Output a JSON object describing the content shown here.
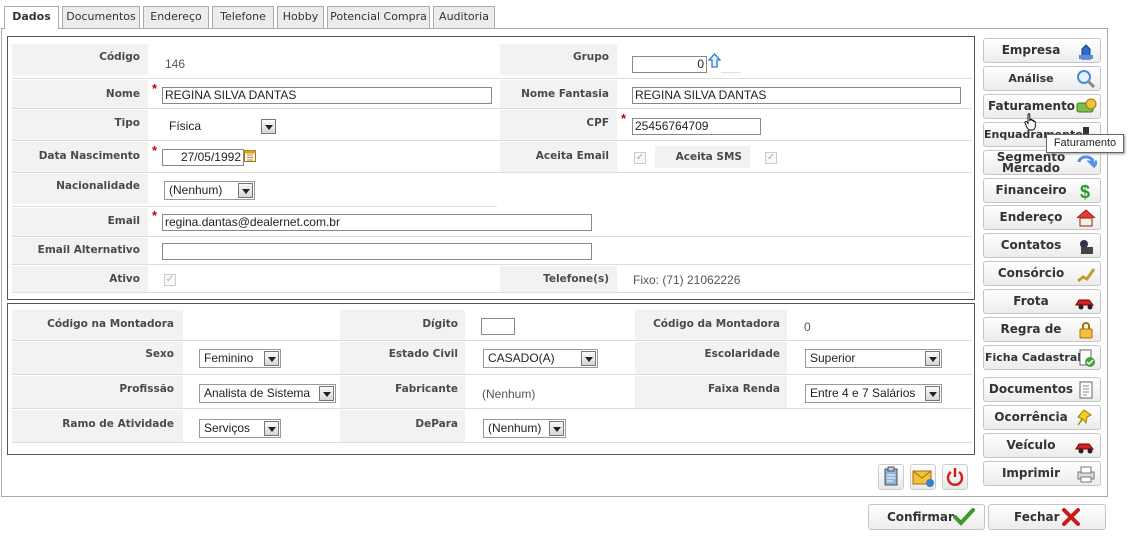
{
  "tabs": [
    "Dados",
    "Documentos",
    "Endereço",
    "Telefone",
    "Hobby",
    "Potencial Compra",
    "Auditoria"
  ],
  "form": {
    "codigo": {
      "label": "Código",
      "value": "146"
    },
    "grupo": {
      "label": "Grupo",
      "value": "0"
    },
    "nome": {
      "label": "Nome",
      "value": "REGINA SILVA DANTAS"
    },
    "nome_fantasia": {
      "label": "Nome Fantasia",
      "value": "REGINA SILVA DANTAS"
    },
    "tipo": {
      "label": "Tipo",
      "value": "Física"
    },
    "cpf": {
      "label": "CPF",
      "value": "25456764709"
    },
    "data_nascimento": {
      "label": "Data Nascimento",
      "value": "27/05/1992"
    },
    "aceita_email": {
      "label": "Aceita Email",
      "checked": true
    },
    "aceita_sms": {
      "label": "Aceita SMS",
      "checked": true
    },
    "nacionalidade": {
      "label": "Nacionalidade",
      "value": "(Nenhum)"
    },
    "email": {
      "label": "Email",
      "value": "regina.dantas@dealernet.com.br"
    },
    "email_alternativo": {
      "label": "Email Alternativo",
      "value": ""
    },
    "ativo": {
      "label": "Ativo",
      "checked": true
    },
    "telefones": {
      "label": "Telefone(s)",
      "value": "Fixo: (71) 21062226"
    }
  },
  "extra": {
    "codigo_na_montadora": {
      "label": "Código na Montadora",
      "value": ""
    },
    "digito": {
      "label": "Dígito",
      "value": ""
    },
    "codigo_da_montadora": {
      "label": "Código da Montadora",
      "value": "0"
    },
    "sexo": {
      "label": "Sexo",
      "value": "Feminino"
    },
    "estado_civil": {
      "label": "Estado Civil",
      "value": "CASADO(A)"
    },
    "escolaridade": {
      "label": "Escolaridade",
      "value": "Superior"
    },
    "profissao": {
      "label": "Profissão",
      "value": "Analista de Sistema"
    },
    "fabricante": {
      "label": "Fabricante",
      "value": "(Nenhum)"
    },
    "faixa_renda": {
      "label": "Faixa Renda",
      "value": "Entre 4 e 7 Salários"
    },
    "ramo_atividade": {
      "label": "Ramo de Atividade",
      "value": "Serviços"
    },
    "depara": {
      "label": "DePara",
      "value": "(Nenhum)"
    }
  },
  "side_buttons": [
    {
      "label": "Empresa",
      "icon": "building-icon"
    },
    {
      "label": "Análise Crédito",
      "icon": "magnifier-icon"
    },
    {
      "label": "Faturamento",
      "icon": "money-icon"
    },
    {
      "label": "Enquadramento",
      "icon": "stamp-icon"
    },
    {
      "label": "Segmento Mercado",
      "icon": "arrows-icon"
    },
    {
      "label": "Financeiro",
      "icon": "dollar-icon"
    },
    {
      "label": "Endereço",
      "icon": "house-icon"
    },
    {
      "label": "Contatos",
      "icon": "phone-icon"
    },
    {
      "label": "Consórcio",
      "icon": "chart-icon"
    },
    {
      "label": "Frota",
      "icon": "car-icon"
    },
    {
      "label": "Regra de Uso",
      "icon": "lock-icon"
    },
    {
      "label": "Ficha Cadastral",
      "icon": "document-check-icon"
    },
    {
      "label": "Documentos",
      "icon": "document-icon"
    },
    {
      "label": "Ocorrência",
      "icon": "pushpin-icon"
    },
    {
      "label": "Veículo",
      "icon": "car-icon"
    },
    {
      "label": "Imprimir",
      "icon": "printer-icon"
    }
  ],
  "tooltip": "Faturamento",
  "footer": {
    "confirm": "Confirmar",
    "close": "Fechar"
  },
  "colors": {
    "required": "#cc0000",
    "confirm_icon": "#3a9a2a",
    "close_icon": "#cc1a1a"
  }
}
